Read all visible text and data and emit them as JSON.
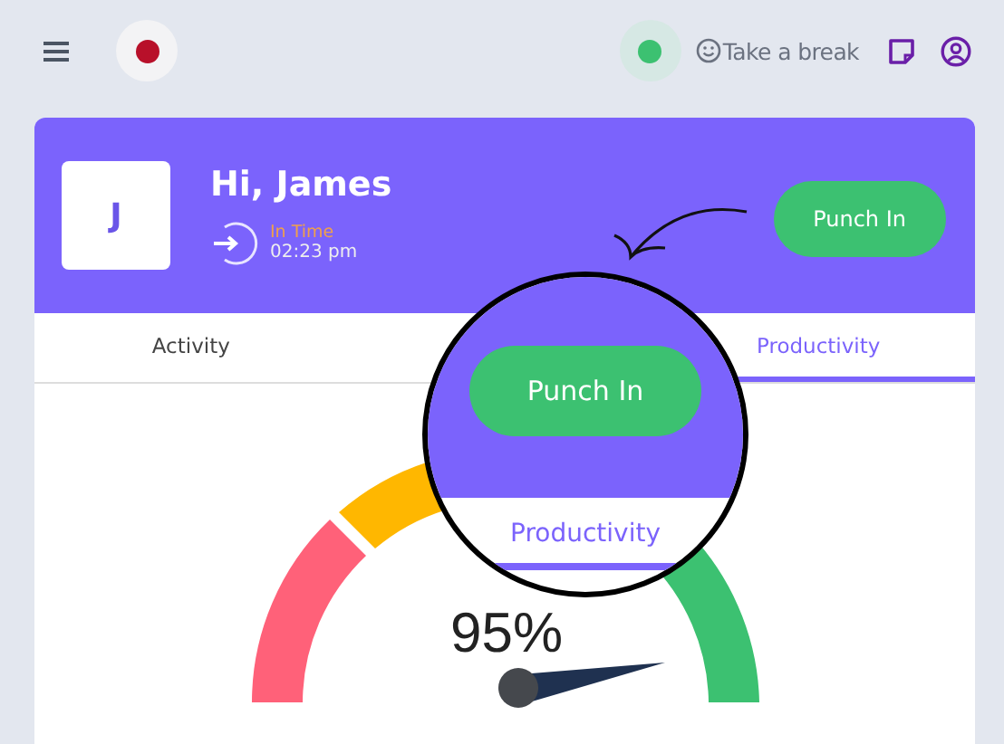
{
  "topbar": {
    "break_label": "Take a break"
  },
  "header": {
    "avatar_initial": "J",
    "greeting": "Hi, James",
    "status": "In Time",
    "time": "02:23 pm",
    "button": "Punch In"
  },
  "tabs": [
    {
      "label": "Activity",
      "selected": false
    },
    {
      "label": "Productivity",
      "selected": true
    }
  ],
  "gauge": {
    "reading": "95%"
  },
  "magnifier": {
    "button": "Punch In",
    "tab": "Productivity",
    "tab_selected": true
  }
}
